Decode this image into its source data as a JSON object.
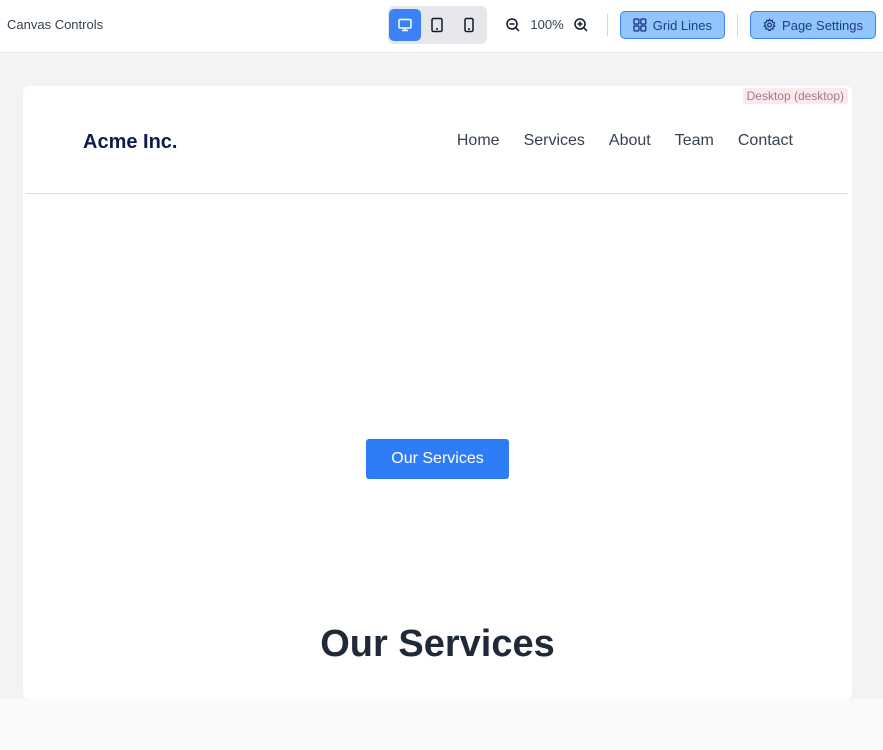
{
  "toolbar": {
    "title": "Canvas Controls",
    "zoom_level": "100%",
    "grid_lines_label": "Grid Lines",
    "page_settings_label": "Page Settings",
    "active_device": "desktop"
  },
  "canvas": {
    "device_badge": "Desktop (desktop)",
    "site": {
      "logo": "Acme Inc.",
      "nav": [
        "Home",
        "Services",
        "About",
        "Team",
        "Contact"
      ],
      "hero_button": "Our Services",
      "section_title": "Our Services"
    }
  },
  "colors": {
    "accent": "#3b82f6",
    "button_blue": "#2f7df6",
    "logo_navy": "#0f1b4c"
  }
}
